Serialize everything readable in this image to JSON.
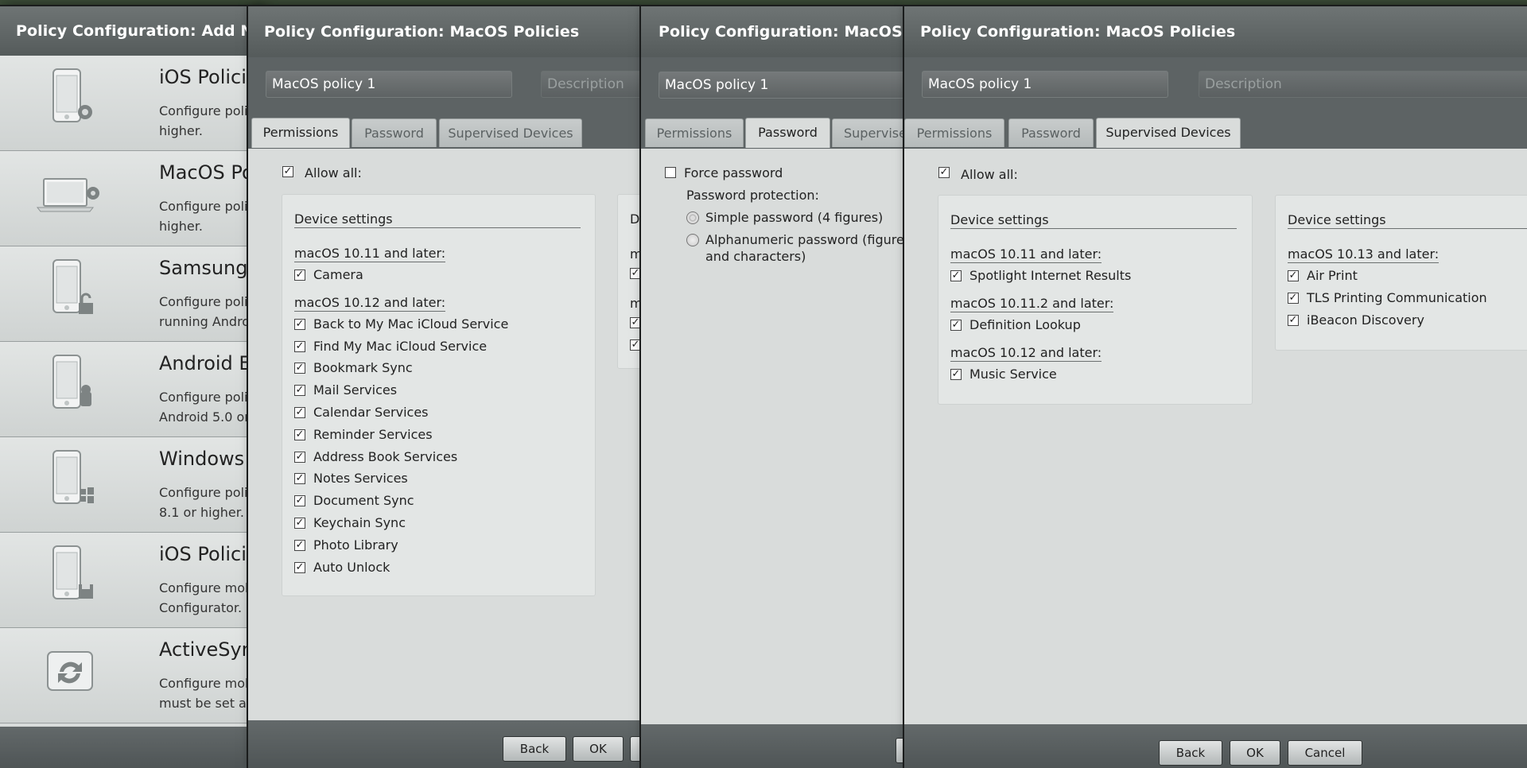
{
  "window_add_new": {
    "title": "Policy Configuration: Add New Policy",
    "items": [
      {
        "title": "iOS Policies",
        "desc_line1": "Configure poli",
        "desc_line2": "higher.",
        "icon": "phone-gear-icon"
      },
      {
        "title": "MacOS Po",
        "desc_line1": "Configure poli",
        "desc_line2": "higher.",
        "icon": "laptop-gear-icon"
      },
      {
        "title": "Samsung",
        "desc_line1": "Configure poli",
        "desc_line2": "running Andro",
        "icon": "phone-lock-icon"
      },
      {
        "title": "Android E",
        "desc_line1": "Configure poli",
        "desc_line2": "Android 5.0 or",
        "icon": "phone-android-icon"
      },
      {
        "title": "Windows",
        "desc_line1": "Configure poli",
        "desc_line2": "8.1 or higher.",
        "icon": "phone-windows-icon"
      },
      {
        "title": "iOS Polici",
        "desc_line1": "Configure mob",
        "desc_line2": "Configurator.",
        "icon": "phone-save-icon"
      },
      {
        "title": "ActiveSyn",
        "desc_line1": "Configure mob",
        "desc_line2": "must be set as",
        "icon": "sync-icon"
      }
    ]
  },
  "window_permissions": {
    "title": "Policy Configuration: MacOS Policies",
    "name_value": "MacOS policy 1",
    "description_placeholder": "Description",
    "tabs": [
      "Permissions",
      "Password",
      "Supervised Devices"
    ],
    "allow_all_label": "Allow all:",
    "panel_title": "Device settings",
    "groups": [
      {
        "header": "macOS 10.11 and later:",
        "items": [
          "Camera"
        ]
      },
      {
        "header": "macOS 10.12 and later:",
        "items": [
          "Back to My Mac iCloud Service",
          "Find My Mac iCloud Service",
          "Bookmark Sync",
          "Mail Services",
          "Calendar Services",
          "Reminder Services",
          "Address Book Services",
          "Notes Services",
          "Document Sync",
          "Keychain Sync",
          "Photo Library",
          "Auto Unlock"
        ]
      }
    ],
    "second_panel_stub": "D",
    "second_panel_stub2": "m",
    "back_label": "Back",
    "ok_label": "OK"
  },
  "window_password": {
    "title": "Policy Configuration: MacOS Policies",
    "name_value": "MacOS policy 1",
    "tabs": [
      "Permissions",
      "Password",
      "Supervise"
    ],
    "force_password_label": "Force password",
    "protection_label": "Password protection:",
    "option_simple": "Simple password (4 figures)",
    "option_alnum_line1": "Alphanumeric password (figures",
    "option_alnum_line2": "and characters)"
  },
  "window_supervised": {
    "title": "Policy Configuration: MacOS Policies",
    "name_value": "MacOS policy 1",
    "description_placeholder": "Description",
    "tabs": [
      "Permissions",
      "Password",
      "Supervised Devices"
    ],
    "allow_all_label": "Allow all:",
    "panel1": {
      "title": "Device settings",
      "groups": [
        {
          "header": "macOS 10.11 and later:",
          "items": [
            "Spotlight Internet Results"
          ]
        },
        {
          "header": "macOS 10.11.2 and later:",
          "items": [
            "Definition Lookup"
          ]
        },
        {
          "header": "macOS 10.12 and later:",
          "items": [
            "Music Service"
          ]
        }
      ]
    },
    "panel2": {
      "title": "Device settings",
      "groups": [
        {
          "header": "macOS 10.13 and later:",
          "items": [
            "Air Print",
            "TLS Printing Communication",
            "iBeacon Discovery"
          ]
        }
      ]
    },
    "back_label": "Back",
    "ok_label": "OK",
    "cancel_label": "Cancel"
  },
  "checkmark": "✓"
}
